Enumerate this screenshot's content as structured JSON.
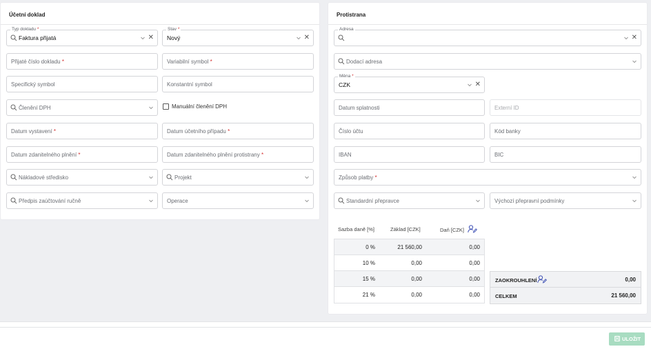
{
  "left_panel": {
    "title": "Účetní doklad",
    "typ_dokladu": {
      "legend": "Typ dokladu",
      "value": "Faktura přijatá"
    },
    "stav": {
      "legend": "Stav",
      "value": "Nový"
    },
    "prijate_cislo": "Přijaté číslo dokladu",
    "variabilni_symbol": "Variabilní symbol",
    "specificky_symbol": "Specifický symbol",
    "konstantni_symbol": "Konstantní symbol",
    "cleneni_dph": "Členění DPH",
    "manualni_cleneni": "Manuální členění DPH",
    "datum_vystaveni": "Datum vystavení",
    "datum_ucetniho_pripadu": "Datum účetního případu",
    "datum_zdanitelneho": "Datum zdanitelného plnění",
    "datum_zdanitelneho_protistrany": "Datum zdanitelného plnění protistrany",
    "nakladove_stredisko": "Nákladové středisko",
    "projekt": "Projekt",
    "predpis": "Předpis zaúčtování ručně",
    "operace": "Operace"
  },
  "right_panel": {
    "title": "Protistrana",
    "adresa": {
      "legend": "Adresa",
      "value": ""
    },
    "dodaci_adresa": "Dodací adresa",
    "mena": {
      "legend": "Měna",
      "value": "CZK"
    },
    "datum_splatnosti": "Datum splatnosti",
    "externi_id": "Externí ID",
    "cislo_uctu": "Číslo účtu",
    "kod_banky": "Kód banky",
    "iban": "IBAN",
    "bic": "BIC",
    "zpusob_platby": "Způsob platby",
    "standardni_prepravce": "Standardní přepravce",
    "vychozi_podminky": "Výchozí přepravní podmínky",
    "vat": {
      "headers": [
        "Sazba daně [%]",
        "Základ [CZK]",
        "Daň [CZK]"
      ],
      "rows": [
        {
          "rate": "0 %",
          "base": "21 560,00",
          "tax": "0,00"
        },
        {
          "rate": "10 %",
          "base": "0,00",
          "tax": "0,00"
        },
        {
          "rate": "15 %",
          "base": "0,00",
          "tax": "0,00"
        },
        {
          "rate": "21 %",
          "base": "0,00",
          "tax": "0,00"
        }
      ]
    },
    "summary": {
      "rounding_label": "ZAOKROUHLENÍ",
      "rounding_value": "0,00",
      "total_label": "CELKEM",
      "total_value": "21 560,00"
    }
  },
  "footer": {
    "save_label": "ULOŽIT"
  },
  "colors": {
    "accent": "#3f51b5",
    "save_button": "#a8dcc1",
    "required": "#d32f2f"
  },
  "icons": {
    "search": "search-icon",
    "dropdown": "chevron-down-icon",
    "clear": "close-icon",
    "edit_person": "user-edit-icon",
    "save": "save-icon"
  }
}
